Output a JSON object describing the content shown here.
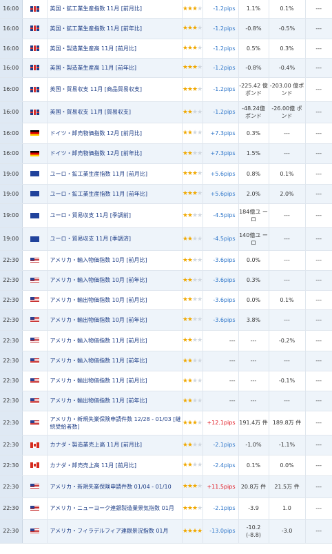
{
  "rows": [
    {
      "time": "16:00",
      "flag": "uk-flag-icon",
      "name": "英国・鉱工業生産指数 11月 [前月比]",
      "stars_on": 3,
      "stars_off": 1,
      "pips": "-1.2pips",
      "pips_sign": "neg",
      "col1": "1.1%",
      "col2": "0.1%",
      "col3": "---"
    },
    {
      "time": "16:00",
      "flag": "uk-flag-icon",
      "name": "英国・鉱工業生産指数 11月 [前年比]",
      "stars_on": 3,
      "stars_off": 1,
      "pips": "-1.2pips",
      "pips_sign": "neg",
      "col1": "-0.8%",
      "col2": "-0.5%",
      "col3": "---"
    },
    {
      "time": "16:00",
      "flag": "uk-flag-icon",
      "name": "英国・製造業生産高 11月 [前月比]",
      "stars_on": 3,
      "stars_off": 1,
      "pips": "-1.2pips",
      "pips_sign": "neg",
      "col1": "0.5%",
      "col2": "0.3%",
      "col3": "---"
    },
    {
      "time": "16:00",
      "flag": "uk-flag-icon",
      "name": "英国・製造業生産高 11月 [前年比]",
      "stars_on": 3,
      "stars_off": 1,
      "pips": "-1.2pips",
      "pips_sign": "neg",
      "col1": "-0.8%",
      "col2": "-0.4%",
      "col3": "---"
    },
    {
      "time": "16:00",
      "flag": "uk-flag-icon",
      "name": "英国・貿易収支 11月 [商品貿易収支]",
      "stars_on": 3,
      "stars_off": 1,
      "pips": "-1.2pips",
      "pips_sign": "neg",
      "col1": "-225.42 億ポンド",
      "col2": "-203.00 億ポンド",
      "col3": "---"
    },
    {
      "time": "16:00",
      "flag": "uk-flag-icon",
      "name": "英国・貿易収支 11月 [貿易収支]",
      "stars_on": 2,
      "stars_off": 2,
      "pips": "-1.2pips",
      "pips_sign": "neg",
      "col1": "-48.24億 ポンド",
      "col2": "-26.00億 ポンド",
      "col3": "---"
    },
    {
      "time": "16:00",
      "flag": "de-flag-icon",
      "name": "ドイツ・卸売物価指数 12月 [前月比]",
      "stars_on": 2,
      "stars_off": 2,
      "pips": "+7.3pips",
      "pips_sign": "neg",
      "col1": "0.3%",
      "col2": "---",
      "col3": "---"
    },
    {
      "time": "16:00",
      "flag": "de-flag-icon",
      "name": "ドイツ・卸売物価指数 12月 [前年比]",
      "stars_on": 2,
      "stars_off": 2,
      "pips": "+7.3pips",
      "pips_sign": "neg",
      "col1": "1.5%",
      "col2": "---",
      "col3": "---"
    },
    {
      "time": "19:00",
      "flag": "eu-flag-icon",
      "name": "ユーロ・鉱工業生産指数 11月 [前月比]",
      "stars_on": 3,
      "stars_off": 1,
      "pips": "+5.6pips",
      "pips_sign": "neg",
      "col1": "0.8%",
      "col2": "0.1%",
      "col3": "---"
    },
    {
      "time": "19:00",
      "flag": "eu-flag-icon",
      "name": "ユーロ・鉱工業生産指数 11月 [前年比]",
      "stars_on": 3,
      "stars_off": 1,
      "pips": "+5.6pips",
      "pips_sign": "neg",
      "col1": "2.0%",
      "col2": "2.0%",
      "col3": "---"
    },
    {
      "time": "19:00",
      "flag": "eu-flag-icon",
      "name": "ユーロ・貿易収支 11月 [季調前]",
      "stars_on": 2,
      "stars_off": 2,
      "pips": "-4.5pips",
      "pips_sign": "neg",
      "col1": "184億ユ ーロ",
      "col2": "---",
      "col3": "---"
    },
    {
      "time": "19:00",
      "flag": "eu-flag-icon",
      "name": "ユーロ・貿易収支 11月 [季調済]",
      "stars_on": 2,
      "stars_off": 2,
      "pips": "-4.5pips",
      "pips_sign": "neg",
      "col1": "140億ユ ーロ",
      "col2": "---",
      "col3": "---"
    },
    {
      "time": "22:30",
      "flag": "us-flag-icon",
      "name": "アメリカ・輸入物価指数 10月 [前月比]",
      "stars_on": 2,
      "stars_off": 2,
      "pips": "-3.6pips",
      "pips_sign": "neg",
      "col1": "0.0%",
      "col2": "---",
      "col3": "---"
    },
    {
      "time": "22:30",
      "flag": "us-flag-icon",
      "name": "アメリカ・輸入物価指数 10月 [前年比]",
      "stars_on": 2,
      "stars_off": 2,
      "pips": "-3.6pips",
      "pips_sign": "neg",
      "col1": "0.3%",
      "col2": "---",
      "col3": "---"
    },
    {
      "time": "22:30",
      "flag": "us-flag-icon",
      "name": "アメリカ・輸出物価指数 10月 [前月比]",
      "stars_on": 2,
      "stars_off": 2,
      "pips": "-3.6pips",
      "pips_sign": "neg",
      "col1": "0.0%",
      "col2": "0.1%",
      "col3": "---"
    },
    {
      "time": "22:30",
      "flag": "us-flag-icon",
      "name": "アメリカ・輸出物価指数 10月 [前年比]",
      "stars_on": 2,
      "stars_off": 2,
      "pips": "-3.6pips",
      "pips_sign": "neg",
      "col1": "3.8%",
      "col2": "---",
      "col3": "---"
    },
    {
      "time": "22:30",
      "flag": "us-flag-icon",
      "name": "アメリカ・輸入物価指数 11月 [前月比]",
      "stars_on": 2,
      "stars_off": 2,
      "pips": "---",
      "pips_sign": "none",
      "col1": "---",
      "col2": "-0.2%",
      "col3": "---"
    },
    {
      "time": "22:30",
      "flag": "us-flag-icon",
      "name": "アメリカ・輸入物価指数 11月 [前年比]",
      "stars_on": 2,
      "stars_off": 2,
      "pips": "---",
      "pips_sign": "none",
      "col1": "---",
      "col2": "---",
      "col3": "---"
    },
    {
      "time": "22:30",
      "flag": "us-flag-icon",
      "name": "アメリカ・輸出物価指数 11月 [前月比]",
      "stars_on": 2,
      "stars_off": 2,
      "pips": "---",
      "pips_sign": "none",
      "col1": "---",
      "col2": "-0.1%",
      "col3": "---"
    },
    {
      "time": "22:30",
      "flag": "us-flag-icon",
      "name": "アメリカ・輸出物価指数 11月 [前年比]",
      "stars_on": 2,
      "stars_off": 2,
      "pips": "---",
      "pips_sign": "none",
      "col1": "---",
      "col2": "---",
      "col3": "---"
    },
    {
      "time": "22:30",
      "flag": "us-flag-icon",
      "name": "アメリカ・新規失業保険申請件数 12/28 - 01/03 [継続受給者数]",
      "stars_on": 3,
      "stars_off": 1,
      "pips": "+12.1pips",
      "pips_sign": "pos",
      "col1": "191.4万 件",
      "col2": "189.8万 件",
      "col3": "---"
    },
    {
      "time": "22:30",
      "flag": "ca-flag-icon",
      "name": "カナダ・製造業売上高 11月 [前月比]",
      "stars_on": 2,
      "stars_off": 2,
      "pips": "-2.1pips",
      "pips_sign": "neg",
      "col1": "-1.0%",
      "col2": "-1.1%",
      "col3": "---"
    },
    {
      "time": "22:30",
      "flag": "ca-flag-icon",
      "name": "カナダ・卸売売上高 11月 [前月比]",
      "stars_on": 2,
      "stars_off": 2,
      "pips": "-2.4pips",
      "pips_sign": "neg",
      "col1": "0.1%",
      "col2": "0.0%",
      "col3": "---"
    },
    {
      "time": "22:30",
      "flag": "us-flag-icon",
      "name": "アメリカ・新規失業保険申請件数 01/04 - 01/10",
      "stars_on": 3,
      "stars_off": 1,
      "pips": "+11.5pips",
      "pips_sign": "pos",
      "col1": "20.8万 件",
      "col2": "21.5万 件",
      "col3": "---"
    },
    {
      "time": "22:30",
      "flag": "us-flag-icon",
      "name": "アメリカ・ニューヨーク連銀製造業景気指数 01月",
      "stars_on": 3,
      "stars_off": 1,
      "pips": "-2.1pips",
      "pips_sign": "neg",
      "col1": "-3.9",
      "col2": "1.0",
      "col3": "---"
    },
    {
      "time": "22:30",
      "flag": "us-flag-icon",
      "name": "アメリカ・フィラデルフィア連銀景況指数 01月",
      "stars_on": 4,
      "stars_off": 0,
      "pips": "-13.0pips",
      "pips_sign": "neg",
      "col1": "-10.2 (-8.8)",
      "col2": "-3.0",
      "col3": "---"
    }
  ],
  "row_heights": [
    26,
    30,
    28,
    28,
    35,
    31,
    30,
    29,
    30,
    28,
    35,
    33,
    29,
    29,
    28,
    30,
    30,
    29,
    29,
    29,
    35,
    29,
    30,
    32,
    31,
    35
  ]
}
